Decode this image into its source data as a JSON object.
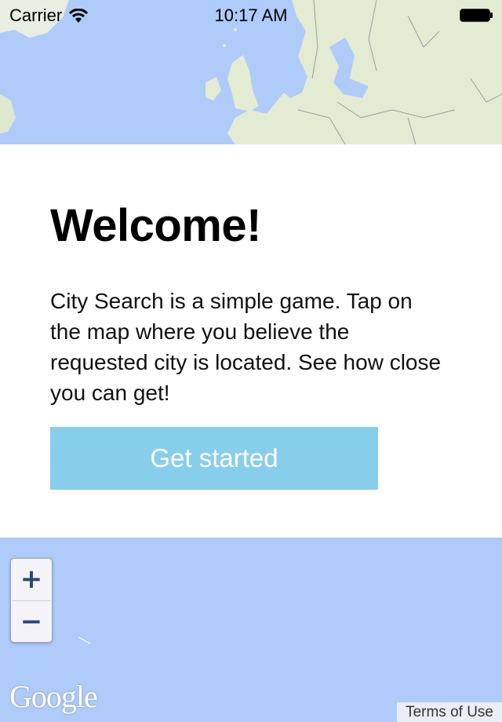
{
  "status_bar": {
    "carrier": "Carrier",
    "time": "10:17 AM"
  },
  "welcome": {
    "title": "Welcome!",
    "body": "City Search is a simple game. Tap on the map where you believe the requested city is located. See how close you can get!",
    "button_label": "Get started"
  },
  "map": {
    "zoom_in": "+",
    "zoom_out": "−",
    "logo": "Google",
    "terms": "Terms of Use"
  },
  "colors": {
    "button": "#87ceeb",
    "water": "#aecbfa",
    "land": "#e3ecd3"
  }
}
